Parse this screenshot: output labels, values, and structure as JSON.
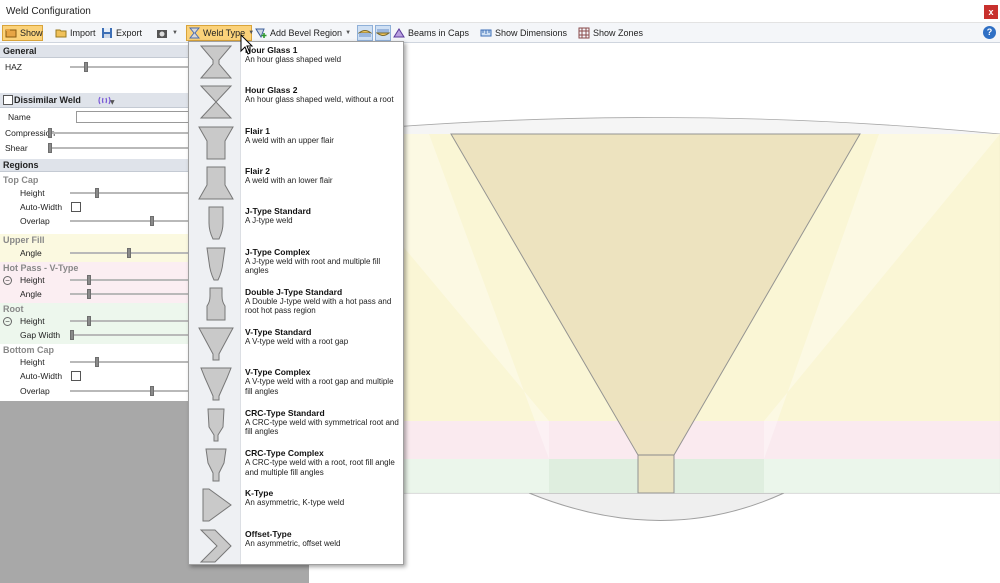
{
  "window": {
    "title": "Weld Configuration",
    "close": "x"
  },
  "toolbar": {
    "show": "Show",
    "import": "Import",
    "export": "Export",
    "weld_type": "Weld Type",
    "add_bevel_region": "Add Bevel Region",
    "beams_in_caps": "Beams in Caps",
    "show_dimensions": "Show Dimensions",
    "show_zones": "Show Zones",
    "help": "?"
  },
  "sidebar": {
    "general": {
      "header": "General",
      "haz": {
        "label": "HAZ",
        "value": 0.12
      }
    },
    "dissimilar": {
      "header": "Dissimilar Weld",
      "name_label": "Name",
      "name_value": "",
      "compression": {
        "label": "Compression",
        "value": 0.0
      },
      "shear": {
        "label": "Shear",
        "value": 0.0
      }
    },
    "regions": {
      "header": "Regions",
      "top_cap": {
        "title": "Top Cap",
        "height_label": "Height",
        "height_value": 0.22,
        "autowidth_label": "Auto-Width",
        "overlap_label": "Overlap",
        "overlap_value": 0.7
      },
      "upper_fill": {
        "title": "Upper Fill",
        "angle_label": "Angle",
        "angle_value": 0.5
      },
      "hot_pass": {
        "title": "Hot Pass - V-Type",
        "height_label": "Height",
        "height_value": 0.15,
        "angle_label": "Angle",
        "angle_value": 0.15
      },
      "root": {
        "title": "Root",
        "height_label": "Height",
        "height_value": 0.15,
        "gap_label": "Gap Width",
        "gap_value": 0.0
      },
      "bottom_cap": {
        "title": "Bottom Cap",
        "height_label": "Height",
        "height_value": 0.22,
        "autowidth_label": "Auto-Width",
        "overlap_label": "Overlap",
        "overlap_value": 0.7
      }
    }
  },
  "weld_types": [
    {
      "title": "Hour Glass 1",
      "desc": "An hour glass shaped weld",
      "icon": "hourglass-1-icon"
    },
    {
      "title": "Hour Glass 2",
      "desc": "An hour glass shaped weld, without a root",
      "icon": "hourglass-2-icon"
    },
    {
      "title": "Flair 1",
      "desc": "A weld with an upper flair",
      "icon": "flair-1-icon"
    },
    {
      "title": "Flair 2",
      "desc": "A weld with an lower flair",
      "icon": "flair-2-icon"
    },
    {
      "title": "J-Type Standard",
      "desc": "A J-type weld",
      "icon": "j-type-standard-icon"
    },
    {
      "title": "J-Type Complex",
      "desc": "A J-type weld with root and multiple fill angles",
      "icon": "j-type-complex-icon"
    },
    {
      "title": "Double J-Type Standard",
      "desc": "A Double J-type weld with a hot pass and root hot pass region",
      "icon": "double-j-type-icon"
    },
    {
      "title": "V-Type Standard",
      "desc": "A V-type weld with a root gap",
      "icon": "v-type-standard-icon"
    },
    {
      "title": "V-Type Complex",
      "desc": "A V-type weld with a root gap and multiple fill angles",
      "icon": "v-type-complex-icon"
    },
    {
      "title": "CRC-Type Standard",
      "desc": "A CRC-type weld with symmetrical root and fill angles",
      "icon": "crc-type-standard-icon"
    },
    {
      "title": "CRC-Type Complex",
      "desc": "A CRC-type weld with a root, root fill angle and multiple fill angles",
      "icon": "crc-type-complex-icon"
    },
    {
      "title": "K-Type",
      "desc": "An asymmetric, K-type weld",
      "icon": "k-type-icon"
    },
    {
      "title": "Offset-Type",
      "desc": "An asymmetric, offset weld",
      "icon": "offset-type-icon"
    }
  ],
  "colors": {
    "accent": "#fbd27a",
    "upper_fill_band": "#fbf6d2",
    "hot_pass_band": "#fbe9ee",
    "root_band": "#eaf6ea",
    "weld_fill": "#ece2bd",
    "weld_stroke": "#8a8a8a"
  }
}
